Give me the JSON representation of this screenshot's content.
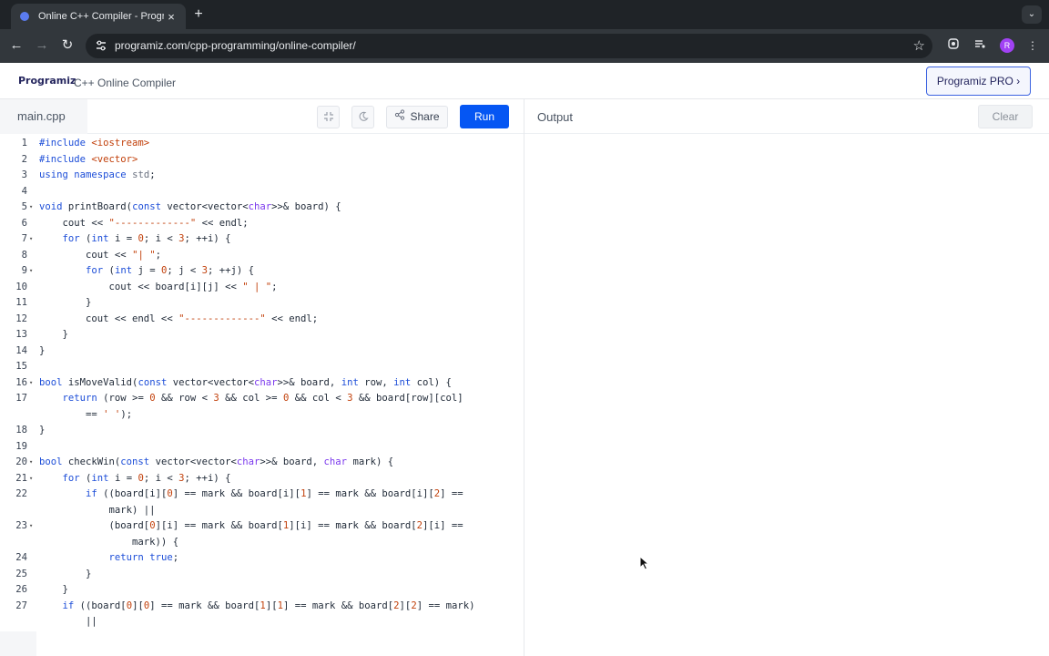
{
  "browser": {
    "tab_title": "Online C++ Compiler - Programiz",
    "url": "programiz.com/cpp-programming/online-compiler/",
    "new_tab_glyph": "+",
    "close_glyph": "×",
    "profile_initial": "R"
  },
  "header": {
    "logo_text": "Programiz",
    "title": "C++ Online Compiler",
    "pro_button": "Programiz PRO ›"
  },
  "editor": {
    "file_name": "main.cpp",
    "share_label": "Share",
    "run_label": "Run"
  },
  "output": {
    "label": "Output",
    "clear_label": "Clear"
  },
  "code": {
    "lines": [
      {
        "n": "1",
        "text": "#include <iostream>"
      },
      {
        "n": "2",
        "text": "#include <vector>"
      },
      {
        "n": "3",
        "text": "using namespace std;"
      },
      {
        "n": "4",
        "text": ""
      },
      {
        "n": "5",
        "text": "void printBoard(const vector<vector<char>>& board) {",
        "fold": true
      },
      {
        "n": "6",
        "text": "    cout << \"-------------\" << endl;"
      },
      {
        "n": "7",
        "text": "    for (int i = 0; i < 3; ++i) {",
        "fold": true
      },
      {
        "n": "8",
        "text": "        cout << \"| \";"
      },
      {
        "n": "9",
        "text": "        for (int j = 0; j < 3; ++j) {",
        "fold": true
      },
      {
        "n": "10",
        "text": "            cout << board[i][j] << \" | \";"
      },
      {
        "n": "11",
        "text": "        }"
      },
      {
        "n": "12",
        "text": "        cout << endl << \"-------------\" << endl;"
      },
      {
        "n": "13",
        "text": "    }"
      },
      {
        "n": "14",
        "text": "}"
      },
      {
        "n": "15",
        "text": ""
      },
      {
        "n": "16",
        "text": "bool isMoveValid(const vector<vector<char>>& board, int row, int col) {",
        "fold": true
      },
      {
        "n": "17",
        "text": "    return (row >= 0 && row < 3 && col >= 0 && col < 3 && board[row][col]"
      },
      {
        "n": "",
        "text": "        == ' ');"
      },
      {
        "n": "18",
        "text": "}"
      },
      {
        "n": "19",
        "text": ""
      },
      {
        "n": "20",
        "text": "bool checkWin(const vector<vector<char>>& board, char mark) {",
        "fold": true
      },
      {
        "n": "21",
        "text": "    for (int i = 0; i < 3; ++i) {",
        "fold": true
      },
      {
        "n": "22",
        "text": "        if ((board[i][0] == mark && board[i][1] == mark && board[i][2] =="
      },
      {
        "n": "",
        "text": "            mark) ||"
      },
      {
        "n": "23",
        "text": "            (board[0][i] == mark && board[1][i] == mark && board[2][i] ==",
        "fold": true
      },
      {
        "n": "",
        "text": "                mark)) {"
      },
      {
        "n": "24",
        "text": "            return true;"
      },
      {
        "n": "25",
        "text": "        }"
      },
      {
        "n": "26",
        "text": "    }"
      },
      {
        "n": "27",
        "text": "    if ((board[0][0] == mark && board[1][1] == mark && board[2][2] == mark)"
      },
      {
        "n": "",
        "text": "        ||"
      }
    ]
  }
}
